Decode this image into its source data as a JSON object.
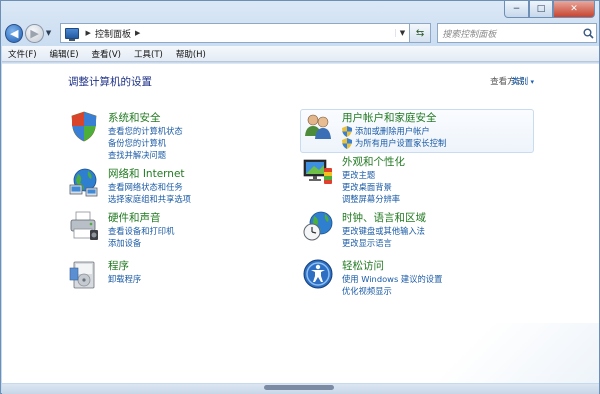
{
  "window": {
    "controls": {
      "minimize": "−",
      "maximize": "□",
      "close": "✕"
    }
  },
  "nav": {
    "address_crumb": "控制面板",
    "search_placeholder": "搜索控制面板"
  },
  "menu": [
    "文件(F)",
    "编辑(E)",
    "查看(V)",
    "工具(T)",
    "帮助(H)"
  ],
  "page": {
    "title": "调整计算机的设置",
    "view_by_label": "查看方式:",
    "view_by_value": "类别"
  },
  "categories": {
    "system": {
      "title": "系统和安全",
      "links": [
        "查看您的计算机状态",
        "备份您的计算机",
        "查找并解决问题"
      ]
    },
    "network": {
      "title": "网络和 Internet",
      "links": [
        "查看网络状态和任务",
        "选择家庭组和共享选项"
      ]
    },
    "hardware": {
      "title": "硬件和声音",
      "links": [
        "查看设备和打印机",
        "添加设备"
      ]
    },
    "programs": {
      "title": "程序",
      "links": [
        "卸载程序"
      ]
    },
    "users": {
      "title": "用户帐户和家庭安全",
      "links": [
        "添加或删除用户帐户",
        "为所有用户设置家长控制"
      ]
    },
    "appearance": {
      "title": "外观和个性化",
      "links": [
        "更改主题",
        "更改桌面背景",
        "调整屏幕分辨率"
      ]
    },
    "clock": {
      "title": "时钟、语言和区域",
      "links": [
        "更改键盘或其他输入法",
        "更改显示语言"
      ]
    },
    "ease": {
      "title": "轻松访问",
      "links": [
        "使用 Windows 建议的设置",
        "优化视频显示"
      ]
    }
  },
  "colors": {
    "category_title": "#217a21",
    "link": "#1a5ba6",
    "page_title": "#1e3287"
  }
}
